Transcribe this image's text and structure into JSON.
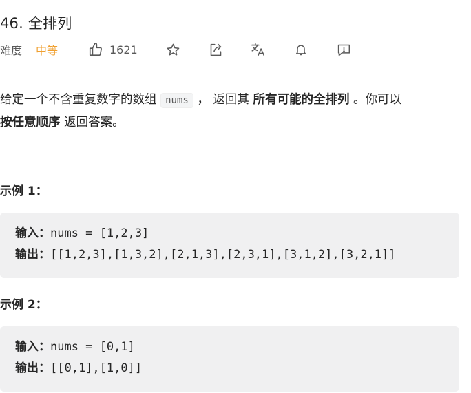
{
  "problem": {
    "title": "46. 全排列",
    "difficulty_label": "难度",
    "difficulty_value": "中等",
    "likes": "1621"
  },
  "toolbar": {
    "icons": [
      "thumbs-up-icon",
      "star-icon",
      "share-icon",
      "translate-icon",
      "bell-icon",
      "feedback-icon"
    ]
  },
  "description": {
    "part1": "给定一个不含重复数字的数组 ",
    "code": "nums",
    "part2": " ， 返回其 ",
    "bold1": "所有可能的全排列",
    "part3": " 。你可以 ",
    "bold2": "按任意顺序",
    "part4": " 返回答案。"
  },
  "examples": [
    {
      "title": "示例 1：",
      "input_label": "输入：",
      "input": "nums = [1,2,3]",
      "output_label": "输出：",
      "output": "[[1,2,3],[1,3,2],[2,1,3],[2,3,1],[3,1,2],[3,2,1]]"
    },
    {
      "title": "示例 2：",
      "input_label": "输入：",
      "input": "nums = [0,1]",
      "output_label": "输出：",
      "output": "[[0,1],[1,0]]"
    }
  ],
  "colors": {
    "medium": "#f0a030",
    "text": "#262626",
    "muted": "#595959",
    "code_bg": "#f0f0f1"
  }
}
